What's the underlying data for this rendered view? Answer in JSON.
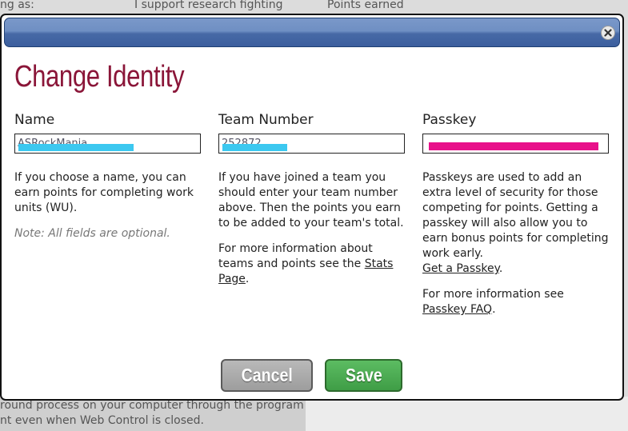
{
  "background": {
    "header_col1": "ng as:",
    "header_col2": "I support research fighting",
    "header_col3": "Points earned",
    "bottom_line1": "round process on your computer through the program",
    "bottom_line2": "nt even when Web Control is closed."
  },
  "dialog": {
    "title": "Change Identity",
    "close_icon": "close-icon",
    "columns": {
      "name": {
        "label": "Name",
        "value": "ASRockMania",
        "redaction_color": "#3cc8f0",
        "text1": "If you choose a name, you can earn points for completing work units (WU).",
        "note": "Note: All fields are optional."
      },
      "team": {
        "label": "Team Number",
        "value": "252872",
        "redaction_color": "#3cc8f0",
        "text1": "If you have joined a team you should enter your team number above. Then the points you earn to be added to your team's total.",
        "text2_prefix": "For more information about teams and points see the ",
        "text2_link": "Stats Page",
        "text2_suffix": "."
      },
      "passkey": {
        "label": "Passkey",
        "value": "",
        "redaction_color": "#e8118a",
        "text1": "Passkeys are used to add an extra level of security for those competing for points. Getting a passkey will also allow you to earn bonus points for completing work early.",
        "text1_link": "Get a Passkey",
        "text1_suffix": ".",
        "text2_prefix": "For more information see ",
        "text2_link": "Passkey FAQ",
        "text2_suffix": "."
      }
    },
    "buttons": {
      "cancel": "Cancel",
      "save": "Save"
    },
    "colors": {
      "title": "#8a1538",
      "titlebar": "#4769a6",
      "save": "#3f9d46",
      "cancel": "#9d9d9d"
    }
  }
}
